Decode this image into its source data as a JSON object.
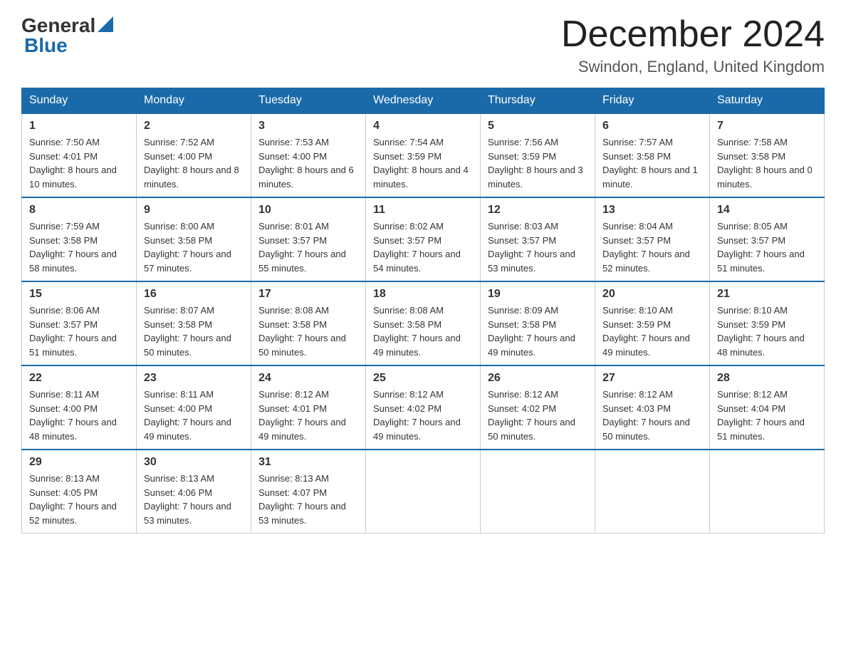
{
  "logo": {
    "general": "General",
    "blue": "Blue"
  },
  "title": "December 2024",
  "location": "Swindon, England, United Kingdom",
  "weekdays": [
    "Sunday",
    "Monday",
    "Tuesday",
    "Wednesday",
    "Thursday",
    "Friday",
    "Saturday"
  ],
  "weeks": [
    [
      {
        "day": "1",
        "sunrise": "7:50 AM",
        "sunset": "4:01 PM",
        "daylight": "8 hours and 10 minutes."
      },
      {
        "day": "2",
        "sunrise": "7:52 AM",
        "sunset": "4:00 PM",
        "daylight": "8 hours and 8 minutes."
      },
      {
        "day": "3",
        "sunrise": "7:53 AM",
        "sunset": "4:00 PM",
        "daylight": "8 hours and 6 minutes."
      },
      {
        "day": "4",
        "sunrise": "7:54 AM",
        "sunset": "3:59 PM",
        "daylight": "8 hours and 4 minutes."
      },
      {
        "day": "5",
        "sunrise": "7:56 AM",
        "sunset": "3:59 PM",
        "daylight": "8 hours and 3 minutes."
      },
      {
        "day": "6",
        "sunrise": "7:57 AM",
        "sunset": "3:58 PM",
        "daylight": "8 hours and 1 minute."
      },
      {
        "day": "7",
        "sunrise": "7:58 AM",
        "sunset": "3:58 PM",
        "daylight": "8 hours and 0 minutes."
      }
    ],
    [
      {
        "day": "8",
        "sunrise": "7:59 AM",
        "sunset": "3:58 PM",
        "daylight": "7 hours and 58 minutes."
      },
      {
        "day": "9",
        "sunrise": "8:00 AM",
        "sunset": "3:58 PM",
        "daylight": "7 hours and 57 minutes."
      },
      {
        "day": "10",
        "sunrise": "8:01 AM",
        "sunset": "3:57 PM",
        "daylight": "7 hours and 55 minutes."
      },
      {
        "day": "11",
        "sunrise": "8:02 AM",
        "sunset": "3:57 PM",
        "daylight": "7 hours and 54 minutes."
      },
      {
        "day": "12",
        "sunrise": "8:03 AM",
        "sunset": "3:57 PM",
        "daylight": "7 hours and 53 minutes."
      },
      {
        "day": "13",
        "sunrise": "8:04 AM",
        "sunset": "3:57 PM",
        "daylight": "7 hours and 52 minutes."
      },
      {
        "day": "14",
        "sunrise": "8:05 AM",
        "sunset": "3:57 PM",
        "daylight": "7 hours and 51 minutes."
      }
    ],
    [
      {
        "day": "15",
        "sunrise": "8:06 AM",
        "sunset": "3:57 PM",
        "daylight": "7 hours and 51 minutes."
      },
      {
        "day": "16",
        "sunrise": "8:07 AM",
        "sunset": "3:58 PM",
        "daylight": "7 hours and 50 minutes."
      },
      {
        "day": "17",
        "sunrise": "8:08 AM",
        "sunset": "3:58 PM",
        "daylight": "7 hours and 50 minutes."
      },
      {
        "day": "18",
        "sunrise": "8:08 AM",
        "sunset": "3:58 PM",
        "daylight": "7 hours and 49 minutes."
      },
      {
        "day": "19",
        "sunrise": "8:09 AM",
        "sunset": "3:58 PM",
        "daylight": "7 hours and 49 minutes."
      },
      {
        "day": "20",
        "sunrise": "8:10 AM",
        "sunset": "3:59 PM",
        "daylight": "7 hours and 49 minutes."
      },
      {
        "day": "21",
        "sunrise": "8:10 AM",
        "sunset": "3:59 PM",
        "daylight": "7 hours and 48 minutes."
      }
    ],
    [
      {
        "day": "22",
        "sunrise": "8:11 AM",
        "sunset": "4:00 PM",
        "daylight": "7 hours and 48 minutes."
      },
      {
        "day": "23",
        "sunrise": "8:11 AM",
        "sunset": "4:00 PM",
        "daylight": "7 hours and 49 minutes."
      },
      {
        "day": "24",
        "sunrise": "8:12 AM",
        "sunset": "4:01 PM",
        "daylight": "7 hours and 49 minutes."
      },
      {
        "day": "25",
        "sunrise": "8:12 AM",
        "sunset": "4:02 PM",
        "daylight": "7 hours and 49 minutes."
      },
      {
        "day": "26",
        "sunrise": "8:12 AM",
        "sunset": "4:02 PM",
        "daylight": "7 hours and 50 minutes."
      },
      {
        "day": "27",
        "sunrise": "8:12 AM",
        "sunset": "4:03 PM",
        "daylight": "7 hours and 50 minutes."
      },
      {
        "day": "28",
        "sunrise": "8:12 AM",
        "sunset": "4:04 PM",
        "daylight": "7 hours and 51 minutes."
      }
    ],
    [
      {
        "day": "29",
        "sunrise": "8:13 AM",
        "sunset": "4:05 PM",
        "daylight": "7 hours and 52 minutes."
      },
      {
        "day": "30",
        "sunrise": "8:13 AM",
        "sunset": "4:06 PM",
        "daylight": "7 hours and 53 minutes."
      },
      {
        "day": "31",
        "sunrise": "8:13 AM",
        "sunset": "4:07 PM",
        "daylight": "7 hours and 53 minutes."
      },
      null,
      null,
      null,
      null
    ]
  ],
  "labels": {
    "sunrise": "Sunrise:",
    "sunset": "Sunset:",
    "daylight": "Daylight:"
  }
}
